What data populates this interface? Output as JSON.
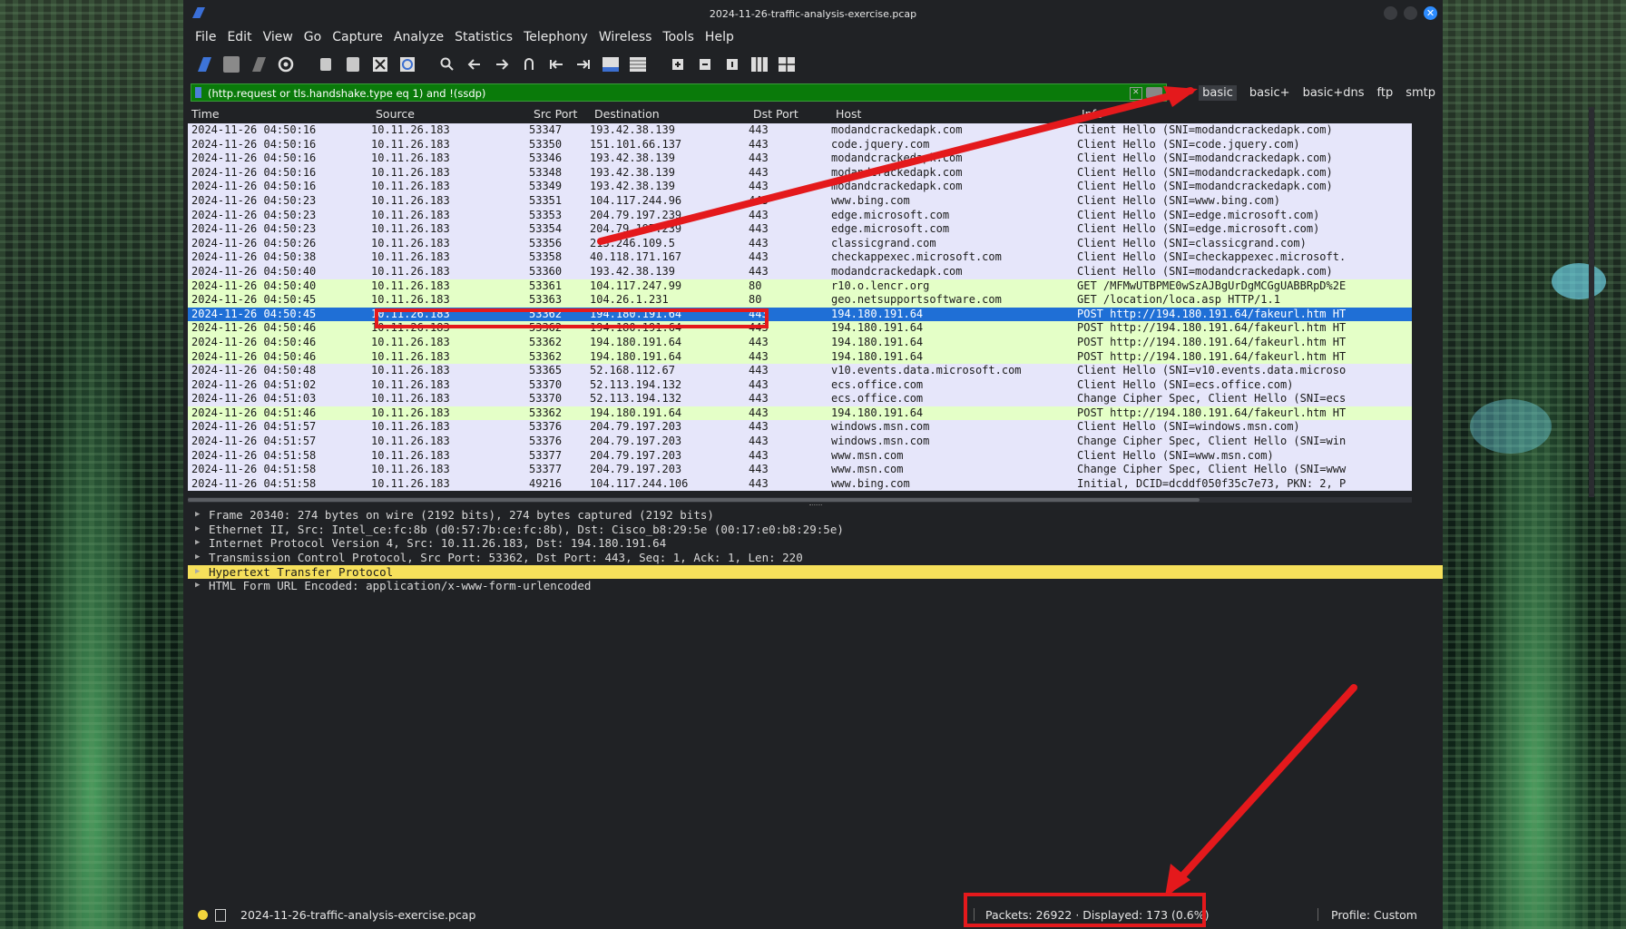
{
  "window": {
    "title": "2024-11-26-traffic-analysis-exercise.pcap",
    "close_glyph": "✕"
  },
  "menu": [
    "File",
    "Edit",
    "View",
    "Go",
    "Capture",
    "Analyze",
    "Statistics",
    "Telephony",
    "Wireless",
    "Tools",
    "Help"
  ],
  "filter": {
    "value": "(http.request or tls.handshake.type eq 1) and !(ssdp)",
    "clear_glyph": "✕",
    "add_glyph": "+",
    "buttons": [
      "basic",
      "basic+",
      "basic+dns",
      "ftp",
      "smtp"
    ]
  },
  "columns": {
    "time": "Time",
    "source": "Source",
    "src_port": "Src Port",
    "destination": "Destination",
    "dst_port": "Dst Port",
    "host": "Host",
    "info": "Info"
  },
  "packets": [
    {
      "time": "2024-11-26 04:50:16",
      "src": "10.11.26.183",
      "sport": "53347",
      "dst": "193.42.38.139",
      "dport": "443",
      "host": "modandcrackedapk.com",
      "info": "Client Hello (SNI=modandcrackedapk.com)",
      "type": "tls"
    },
    {
      "time": "2024-11-26 04:50:16",
      "src": "10.11.26.183",
      "sport": "53350",
      "dst": "151.101.66.137",
      "dport": "443",
      "host": "code.jquery.com",
      "info": "Client Hello (SNI=code.jquery.com)",
      "type": "tls"
    },
    {
      "time": "2024-11-26 04:50:16",
      "src": "10.11.26.183",
      "sport": "53346",
      "dst": "193.42.38.139",
      "dport": "443",
      "host": "modandcrackedapk.com",
      "info": "Client Hello (SNI=modandcrackedapk.com)",
      "type": "tls"
    },
    {
      "time": "2024-11-26 04:50:16",
      "src": "10.11.26.183",
      "sport": "53348",
      "dst": "193.42.38.139",
      "dport": "443",
      "host": "modandcrackedapk.com",
      "info": "Client Hello (SNI=modandcrackedapk.com)",
      "type": "tls"
    },
    {
      "time": "2024-11-26 04:50:16",
      "src": "10.11.26.183",
      "sport": "53349",
      "dst": "193.42.38.139",
      "dport": "443",
      "host": "modandcrackedapk.com",
      "info": "Client Hello (SNI=modandcrackedapk.com)",
      "type": "tls"
    },
    {
      "time": "2024-11-26 04:50:23",
      "src": "10.11.26.183",
      "sport": "53351",
      "dst": "104.117.244.96",
      "dport": "443",
      "host": "www.bing.com",
      "info": "Client Hello (SNI=www.bing.com)",
      "type": "tls"
    },
    {
      "time": "2024-11-26 04:50:23",
      "src": "10.11.26.183",
      "sport": "53353",
      "dst": "204.79.197.239",
      "dport": "443",
      "host": "edge.microsoft.com",
      "info": "Client Hello (SNI=edge.microsoft.com)",
      "type": "tls"
    },
    {
      "time": "2024-11-26 04:50:23",
      "src": "10.11.26.183",
      "sport": "53354",
      "dst": "204.79.197.239",
      "dport": "443",
      "host": "edge.microsoft.com",
      "info": "Client Hello (SNI=edge.microsoft.com)",
      "type": "tls"
    },
    {
      "time": "2024-11-26 04:50:26",
      "src": "10.11.26.183",
      "sport": "53356",
      "dst": "213.246.109.5",
      "dport": "443",
      "host": "classicgrand.com",
      "info": "Client Hello (SNI=classicgrand.com)",
      "type": "tls"
    },
    {
      "time": "2024-11-26 04:50:38",
      "src": "10.11.26.183",
      "sport": "53358",
      "dst": "40.118.171.167",
      "dport": "443",
      "host": "checkappexec.microsoft.com",
      "info": "Client Hello (SNI=checkappexec.microsoft.",
      "type": "tls"
    },
    {
      "time": "2024-11-26 04:50:40",
      "src": "10.11.26.183",
      "sport": "53360",
      "dst": "193.42.38.139",
      "dport": "443",
      "host": "modandcrackedapk.com",
      "info": "Client Hello (SNI=modandcrackedapk.com)",
      "type": "tls"
    },
    {
      "time": "2024-11-26 04:50:40",
      "src": "10.11.26.183",
      "sport": "53361",
      "dst": "104.117.247.99",
      "dport": "80",
      "host": "r10.o.lencr.org",
      "info": "GET /MFMwUTBPME0wSzAJBgUrDgMCGgUABBRpD%2E",
      "type": "http"
    },
    {
      "time": "2024-11-26 04:50:45",
      "src": "10.11.26.183",
      "sport": "53363",
      "dst": "104.26.1.231",
      "dport": "80",
      "host": "geo.netsupportsoftware.com",
      "info": "GET /location/loca.asp HTTP/1.1",
      "type": "http"
    },
    {
      "time": "2024-11-26 04:50:45",
      "src": "10.11.26.183",
      "sport": "53362",
      "dst": "194.180.191.64",
      "dport": "443",
      "host": "194.180.191.64",
      "info": "POST http://194.180.191.64/fakeurl.htm HT",
      "type": "sel"
    },
    {
      "time": "2024-11-26 04:50:46",
      "src": "10.11.26.183",
      "sport": "53362",
      "dst": "194.180.191.64",
      "dport": "443",
      "host": "194.180.191.64",
      "info": "POST http://194.180.191.64/fakeurl.htm HT",
      "type": "http"
    },
    {
      "time": "2024-11-26 04:50:46",
      "src": "10.11.26.183",
      "sport": "53362",
      "dst": "194.180.191.64",
      "dport": "443",
      "host": "194.180.191.64",
      "info": "POST http://194.180.191.64/fakeurl.htm HT",
      "type": "http"
    },
    {
      "time": "2024-11-26 04:50:46",
      "src": "10.11.26.183",
      "sport": "53362",
      "dst": "194.180.191.64",
      "dport": "443",
      "host": "194.180.191.64",
      "info": "POST http://194.180.191.64/fakeurl.htm HT",
      "type": "http"
    },
    {
      "time": "2024-11-26 04:50:48",
      "src": "10.11.26.183",
      "sport": "53365",
      "dst": "52.168.112.67",
      "dport": "443",
      "host": "v10.events.data.microsoft.com",
      "info": "Client Hello (SNI=v10.events.data.microso",
      "type": "tls"
    },
    {
      "time": "2024-11-26 04:51:02",
      "src": "10.11.26.183",
      "sport": "53370",
      "dst": "52.113.194.132",
      "dport": "443",
      "host": "ecs.office.com",
      "info": "Client Hello (SNI=ecs.office.com)",
      "type": "tls"
    },
    {
      "time": "2024-11-26 04:51:03",
      "src": "10.11.26.183",
      "sport": "53370",
      "dst": "52.113.194.132",
      "dport": "443",
      "host": "ecs.office.com",
      "info": "Change Cipher Spec, Client Hello (SNI=ecs",
      "type": "tls"
    },
    {
      "time": "2024-11-26 04:51:46",
      "src": "10.11.26.183",
      "sport": "53362",
      "dst": "194.180.191.64",
      "dport": "443",
      "host": "194.180.191.64",
      "info": "POST http://194.180.191.64/fakeurl.htm HT",
      "type": "http"
    },
    {
      "time": "2024-11-26 04:51:57",
      "src": "10.11.26.183",
      "sport": "53376",
      "dst": "204.79.197.203",
      "dport": "443",
      "host": "windows.msn.com",
      "info": "Client Hello (SNI=windows.msn.com)",
      "type": "tls"
    },
    {
      "time": "2024-11-26 04:51:57",
      "src": "10.11.26.183",
      "sport": "53376",
      "dst": "204.79.197.203",
      "dport": "443",
      "host": "windows.msn.com",
      "info": "Change Cipher Spec, Client Hello (SNI=win",
      "type": "tls"
    },
    {
      "time": "2024-11-26 04:51:58",
      "src": "10.11.26.183",
      "sport": "53377",
      "dst": "204.79.197.203",
      "dport": "443",
      "host": "www.msn.com",
      "info": "Client Hello (SNI=www.msn.com)",
      "type": "tls"
    },
    {
      "time": "2024-11-26 04:51:58",
      "src": "10.11.26.183",
      "sport": "53377",
      "dst": "204.79.197.203",
      "dport": "443",
      "host": "www.msn.com",
      "info": "Change Cipher Spec, Client Hello (SNI=www",
      "type": "tls"
    },
    {
      "time": "2024-11-26 04:51:58",
      "src": "10.11.26.183",
      "sport": "49216",
      "dst": "104.117.244.106",
      "dport": "443",
      "host": "www.bing.com",
      "info": "Initial, DCID=dcddf050f35c7e73, PKN: 2, P",
      "type": "tls"
    }
  ],
  "details": [
    "Frame 20340: 274 bytes on wire (2192 bits), 274 bytes captured (2192 bits)",
    "Ethernet II, Src: Intel_ce:fc:8b (d0:57:7b:ce:fc:8b), Dst: Cisco_b8:29:5e (00:17:e0:b8:29:5e)",
    "Internet Protocol Version 4, Src: 10.11.26.183, Dst: 194.180.191.64",
    "Transmission Control Protocol, Src Port: 53362, Dst Port: 443, Seq: 1, Ack: 1, Len: 220",
    "Hypertext Transfer Protocol",
    "HTML Form URL Encoded: application/x-www-form-urlencoded"
  ],
  "status": {
    "file": "2024-11-26-traffic-analysis-exercise.pcap",
    "packets": "Packets: 26922 · Displayed: 173 (0.6%)",
    "profile": "Profile: Custom"
  },
  "colors": {
    "annotation": "#e4191c",
    "selected_row": "#1f6fd6",
    "tls_row": "#e6e6fa",
    "http_row": "#e4ffc7",
    "filter_valid": "#0a7a0a",
    "highlight": "#f6e05b"
  }
}
